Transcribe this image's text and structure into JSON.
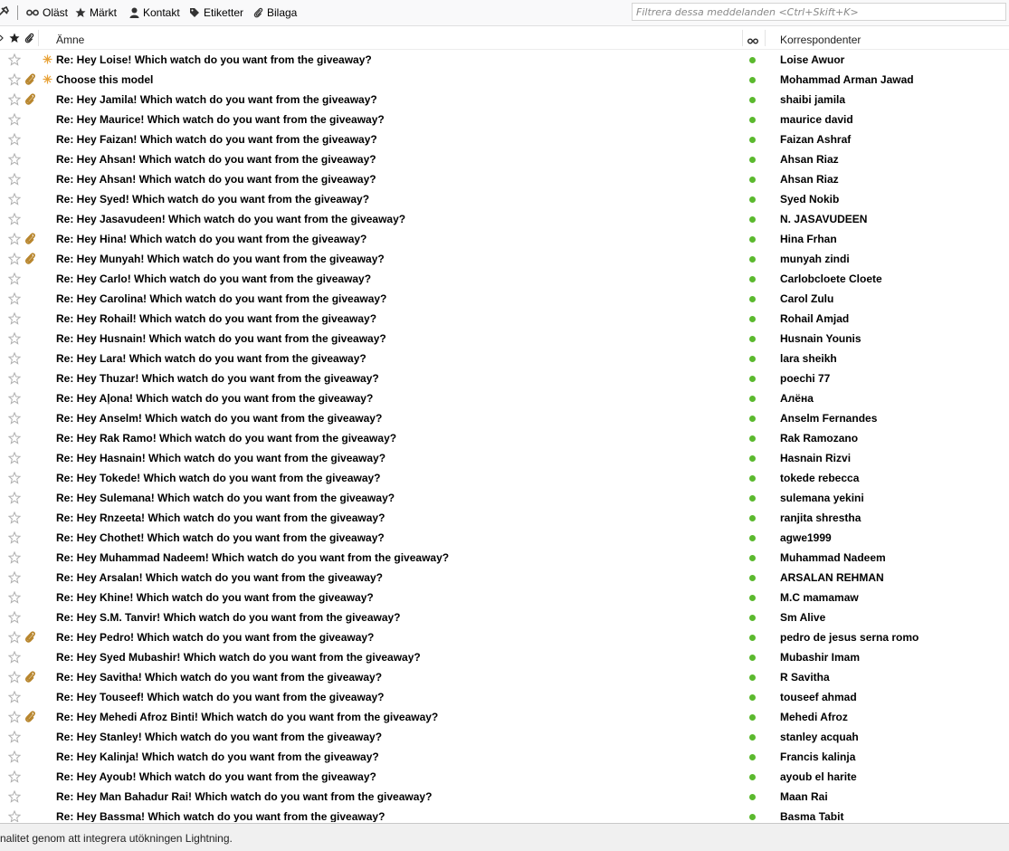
{
  "quick_filter": {
    "unread": "Oläst",
    "starred": "Märkt",
    "contact": "Kontakt",
    "tags": "Etiketter",
    "attachment": "Bilaga",
    "filter_placeholder": "Filtrera dessa meddelanden <Ctrl+Skift+K>"
  },
  "columns": {
    "subject": "Ämne",
    "correspondents": "Korrespondenter"
  },
  "colors": {
    "read_dot": "#5bb92e",
    "star_outline": "#b0b0b0",
    "attachment": "#b8862e",
    "new_marker": "#e8a33a"
  },
  "messages": [
    {
      "subject": "Re: Hey Loise! Which watch do you want from the giveaway?",
      "correspondent": "Loise Awuor",
      "attachment": false,
      "new": true
    },
    {
      "subject": "Choose this model",
      "correspondent": "Mohammad Arman Jawad",
      "attachment": true,
      "new": true
    },
    {
      "subject": "Re: Hey Jamila! Which watch do you want from the giveaway?",
      "correspondent": "shaibi jamila",
      "attachment": true,
      "new": false
    },
    {
      "subject": "Re: Hey Maurice! Which watch do you want from the giveaway?",
      "correspondent": "maurice david",
      "attachment": false,
      "new": false
    },
    {
      "subject": "Re: Hey Faizan! Which watch do you want from the giveaway?",
      "correspondent": "Faizan Ashraf",
      "attachment": false,
      "new": false
    },
    {
      "subject": "Re: Hey Ahsan! Which watch do you want from the giveaway?",
      "correspondent": "Ahsan Riaz",
      "attachment": false,
      "new": false
    },
    {
      "subject": "Re: Hey Ahsan! Which watch do you want from the giveaway?",
      "correspondent": "Ahsan Riaz",
      "attachment": false,
      "new": false
    },
    {
      "subject": "Re: Hey Syed! Which watch do you want from the giveaway?",
      "correspondent": "Syed Nokib",
      "attachment": false,
      "new": false
    },
    {
      "subject": "Re: Hey Jasavudeen! Which watch do you want from the giveaway?",
      "correspondent": "N. JASAVUDEEN",
      "attachment": false,
      "new": false
    },
    {
      "subject": "Re: Hey Hina! Which watch do you want from the giveaway?",
      "correspondent": "Hina Frhan",
      "attachment": true,
      "new": false
    },
    {
      "subject": "Re: Hey Munyah! Which watch do you want from the giveaway?",
      "correspondent": "munyah zindi",
      "attachment": true,
      "new": false
    },
    {
      "subject": "Re: Hey Carlo! Which watch do you want from the giveaway?",
      "correspondent": "Carlobcloete Cloete",
      "attachment": false,
      "new": false
    },
    {
      "subject": "Re: Hey Carolina! Which watch do you want from the giveaway?",
      "correspondent": "Carol Zulu",
      "attachment": false,
      "new": false
    },
    {
      "subject": "Re: Hey Rohail! Which watch do you want from the giveaway?",
      "correspondent": "Rohail Amjad",
      "attachment": false,
      "new": false
    },
    {
      "subject": "Re: Hey Husnain! Which watch do you want from the giveaway?",
      "correspondent": "Husnain Younis",
      "attachment": false,
      "new": false
    },
    {
      "subject": "Re: Hey Lara! Which watch do you want from the giveaway?",
      "correspondent": "lara sheikh",
      "attachment": false,
      "new": false
    },
    {
      "subject": "Re: Hey Thuzar! Which watch do you want from the giveaway?",
      "correspondent": "poechi 77",
      "attachment": false,
      "new": false
    },
    {
      "subject": "Re: Hey Aļona! Which watch do you want from the giveaway?",
      "correspondent": "Алёна",
      "attachment": false,
      "new": false
    },
    {
      "subject": "Re: Hey Anselm! Which watch do you want from the giveaway?",
      "correspondent": "Anselm Fernandes",
      "attachment": false,
      "new": false
    },
    {
      "subject": "Re: Hey Rak Ramo! Which watch do you want from the giveaway?",
      "correspondent": "Rak Ramozano",
      "attachment": false,
      "new": false
    },
    {
      "subject": "Re: Hey Hasnain! Which watch do you want from the giveaway?",
      "correspondent": "Hasnain Rizvi",
      "attachment": false,
      "new": false
    },
    {
      "subject": "Re: Hey Tokede! Which watch do you want from the giveaway?",
      "correspondent": "tokede rebecca",
      "attachment": false,
      "new": false
    },
    {
      "subject": "Re: Hey Sulemana! Which watch do you want from the giveaway?",
      "correspondent": "sulemana yekini",
      "attachment": false,
      "new": false
    },
    {
      "subject": "Re: Hey Rnzeeta! Which watch do you want from the giveaway?",
      "correspondent": "ranjita shrestha",
      "attachment": false,
      "new": false
    },
    {
      "subject": "Re: Hey Chothet! Which watch do you want from the giveaway?",
      "correspondent": "agwe1999",
      "attachment": false,
      "new": false
    },
    {
      "subject": "Re: Hey Muhammad Nadeem! Which watch do you want from the giveaway?",
      "correspondent": "Muhammad Nadeem",
      "attachment": false,
      "new": false
    },
    {
      "subject": "Re: Hey Arsalan! Which watch do you want from the giveaway?",
      "correspondent": "ARSALAN REHMAN",
      "attachment": false,
      "new": false
    },
    {
      "subject": "Re: Hey Khine! Which watch do you want from the giveaway?",
      "correspondent": "M.C mamamaw",
      "attachment": false,
      "new": false
    },
    {
      "subject": "Re: Hey S.M. Tanvir! Which watch do you want from the giveaway?",
      "correspondent": "Sm Alive",
      "attachment": false,
      "new": false
    },
    {
      "subject": "Re: Hey Pedro! Which watch do you want from the giveaway?",
      "correspondent": "pedro de jesus serna romo",
      "attachment": true,
      "new": false
    },
    {
      "subject": "Re: Hey Syed Mubashir! Which watch do you want from the giveaway?",
      "correspondent": "Mubashir Imam",
      "attachment": false,
      "new": false
    },
    {
      "subject": "Re: Hey Savitha! Which watch do you want from the giveaway?",
      "correspondent": "R Savitha",
      "attachment": true,
      "new": false
    },
    {
      "subject": "Re: Hey Touseef! Which watch do you want from the giveaway?",
      "correspondent": "touseef ahmad",
      "attachment": false,
      "new": false
    },
    {
      "subject": "Re: Hey Mehedi Afroz Binti! Which watch do you want from the giveaway?",
      "correspondent": "Mehedi Afroz",
      "attachment": true,
      "new": false
    },
    {
      "subject": "Re: Hey Stanley! Which watch do you want from the giveaway?",
      "correspondent": "stanley acquah",
      "attachment": false,
      "new": false
    },
    {
      "subject": "Re: Hey Kalinja! Which watch do you want from the giveaway?",
      "correspondent": "Francis kalinja",
      "attachment": false,
      "new": false
    },
    {
      "subject": "Re: Hey Ayoub! Which watch do you want from the giveaway?",
      "correspondent": "ayoub el harite",
      "attachment": false,
      "new": false
    },
    {
      "subject": "Re: Hey Man Bahadur Rai! Which watch do you want from the giveaway?",
      "correspondent": "Maan Rai",
      "attachment": false,
      "new": false
    },
    {
      "subject": "Re: Hey Bassma! Which watch do you want from the giveaway?",
      "correspondent": "Basma Tabit",
      "attachment": false,
      "new": false
    }
  ],
  "status_text": "nalitet genom att integrera utökningen Lightning."
}
